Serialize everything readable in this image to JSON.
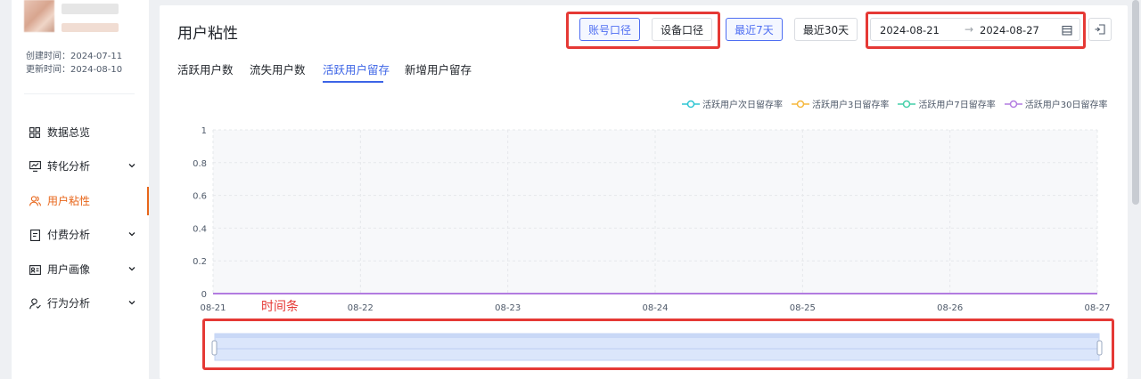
{
  "sidebar": {
    "created": "创建时间：2024-07-11",
    "updated": "更新时间：2024-08-10",
    "items": [
      {
        "label": "数据总览",
        "icon": "grid-icon"
      },
      {
        "label": "转化分析",
        "icon": "monitor-chart-icon"
      },
      {
        "label": "用户粘性",
        "icon": "users-icon"
      },
      {
        "label": "付费分析",
        "icon": "receipt-icon"
      },
      {
        "label": "用户画像",
        "icon": "id-card-icon"
      },
      {
        "label": "行为分析",
        "icon": "user-action-icon"
      }
    ]
  },
  "header": {
    "title": "用户粘性",
    "account_label": "账号口径",
    "device_label": "设备口径",
    "last7_label": "最近7天",
    "last30_label": "最近30天",
    "date_start": "2024-08-21",
    "date_arrow": "→",
    "date_end": "2024-08-27"
  },
  "tabs": [
    "活跃用户数",
    "流失用户数",
    "活跃用户留存",
    "新增用户留存"
  ],
  "annotation": "时间条",
  "colors": {
    "accent": "#3c64e6",
    "active_nav": "#e8661a",
    "annotation_red": "#e53935"
  },
  "chart_data": {
    "type": "line",
    "categories": [
      "08-21",
      "08-22",
      "08-23",
      "08-24",
      "08-25",
      "08-26",
      "08-27"
    ],
    "ylim": [
      0,
      1
    ],
    "yticks": [
      "0",
      "0.2",
      "0.4",
      "0.6",
      "0.8",
      "1"
    ],
    "legend_position": "top-right",
    "series": [
      {
        "name": "活跃用户次日留存率",
        "color": "#2ec5d3",
        "values": [
          0,
          0,
          0,
          0,
          0,
          0,
          0
        ]
      },
      {
        "name": "活跃用户3日留存率",
        "color": "#f5b73b",
        "values": [
          0,
          0,
          0,
          0,
          0,
          0,
          0
        ]
      },
      {
        "name": "活跃用户7日留存率",
        "color": "#43cfa8",
        "values": [
          0,
          0,
          0,
          0,
          0,
          0,
          0
        ]
      },
      {
        "name": "活跃用户30日留存率",
        "color": "#b27be0",
        "values": [
          0,
          0,
          0,
          0,
          0,
          0,
          0
        ]
      }
    ]
  }
}
